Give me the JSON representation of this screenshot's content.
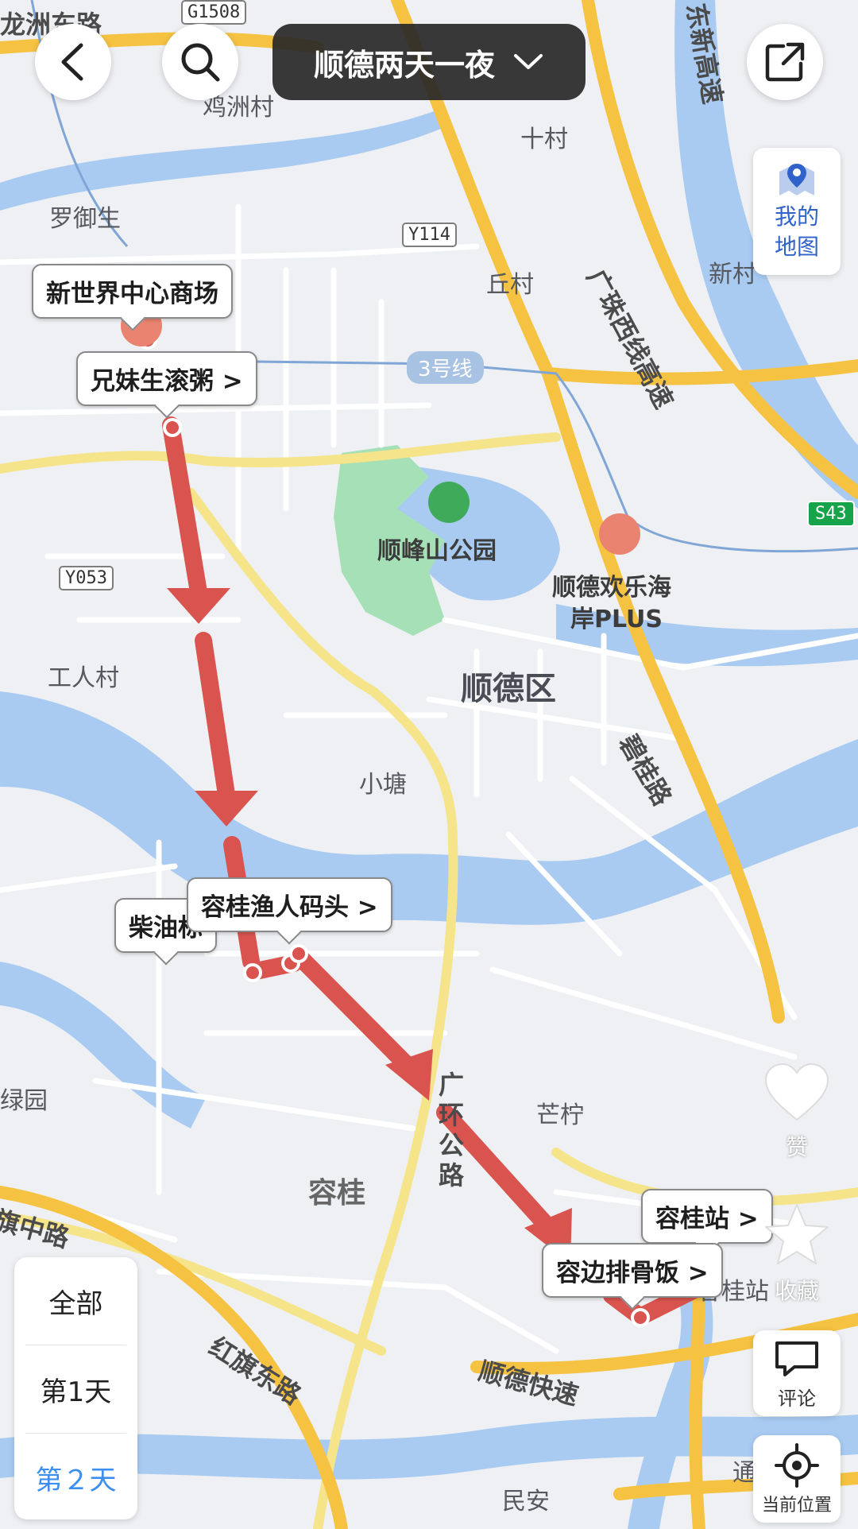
{
  "header": {
    "title": "顺德两天一夜"
  },
  "icons": {
    "back": "chevron-left-icon",
    "search": "search-icon",
    "share": "share-icon",
    "dropdown": "chevron-down-icon",
    "my_map": "map-pin-icon",
    "like": "heart-icon",
    "favorite": "star-icon",
    "comment": "comment-icon",
    "locate": "locate-icon"
  },
  "side": {
    "my_map_line1": "我的",
    "my_map_line2": "地图",
    "like_label": "赞",
    "favorite_label": "收藏",
    "comment_label": "评论",
    "locate_label": "当前位置"
  },
  "days": {
    "all": "全部",
    "day1": "第1天",
    "day2": "第２天",
    "active": "day2"
  },
  "pois": {
    "new_world": "新世界中心商场",
    "xiongmei": "兄妹生滚粥 >",
    "chaiyou": "柴油标",
    "ronggui_pier_callout": "容桂渔人码头 >",
    "ronggui_pier_map": "容桂渔人码头",
    "ronggui_station": "容桂站 >",
    "rongbian": "容边排骨饭 >"
  },
  "map_labels": {
    "longzhou_road": "龙洲东路",
    "jizhou": "鸡洲村",
    "shicun": "十村",
    "luoyusheng": "罗御生",
    "qiucun": "丘村",
    "xinsu": "新村",
    "shunfeng_park": "顺峰山公园",
    "happy_coast": "顺德欢乐海",
    "happy_coast2": "岸PLUS",
    "gongren": "工人村",
    "shunde_district": "顺德区",
    "xiaotang": "小塘",
    "manning": "芒柠",
    "ronggui": "容桂",
    "hongqi_east": "红旗东路",
    "qi_middle": "旗中路",
    "shunde_expressway": "顺德快速",
    "min_an": "民安",
    "lu_yuan": "绿园",
    "ronggui_station_map": "容桂站",
    "tong": "通",
    "guihuan": "广环公路",
    "biqui": "碧桂路",
    "zhuxi_expressway": "广珠西线高速",
    "east_expressway": "东新高速",
    "metro3": "3号线"
  },
  "shields": {
    "g1508": "G1508",
    "y114": "Y114",
    "y053": "Y053",
    "s43": "S43"
  },
  "colors": {
    "route": "#d9534f",
    "highway": "#f5c242",
    "water": "#a9cbf2",
    "park": "#a6e0b7",
    "active_day": "#3b8ff0"
  }
}
